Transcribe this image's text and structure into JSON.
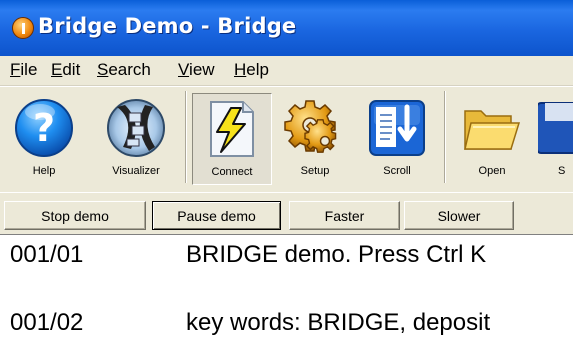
{
  "window": {
    "title": "Bridge Demo - Bridge"
  },
  "menu": [
    {
      "label": "File",
      "mnemonic": "F",
      "rest": "ile"
    },
    {
      "label": "Edit",
      "mnemonic": "E",
      "rest": "dit"
    },
    {
      "label": "Search",
      "mnemonic": "S",
      "rest": "earch"
    },
    {
      "label": "View",
      "mnemonic": "V",
      "rest": "iew"
    },
    {
      "label": "Help",
      "mnemonic": "H",
      "rest": "elp"
    }
  ],
  "toolbar": {
    "items": [
      {
        "label": "Help",
        "icon": "help-icon"
      },
      {
        "label": "Visualizer",
        "icon": "visualizer-icon"
      },
      {
        "label": "Connect",
        "icon": "connect-icon",
        "pressed": true
      },
      {
        "label": "Setup",
        "icon": "setup-icon"
      },
      {
        "label": "Scroll",
        "icon": "scroll-icon"
      },
      {
        "label": "Open",
        "icon": "open-folder-icon"
      },
      {
        "label": "S",
        "icon": "save-icon"
      }
    ]
  },
  "buttons": [
    {
      "label": "Stop demo"
    },
    {
      "label": "Pause demo",
      "focused": true
    },
    {
      "label": "Faster"
    },
    {
      "label": "Slower"
    }
  ],
  "display": {
    "lines": [
      {
        "number": "001/01",
        "text": "BRIDGE demo.  Press Ctrl K"
      },
      {
        "number": "001/02",
        "text": "key words:  BRIDGE, deposit"
      }
    ]
  },
  "colors": {
    "titlebar": "#1a66e0",
    "chrome": "#ece9d8",
    "display_bg": "#ffffff"
  }
}
